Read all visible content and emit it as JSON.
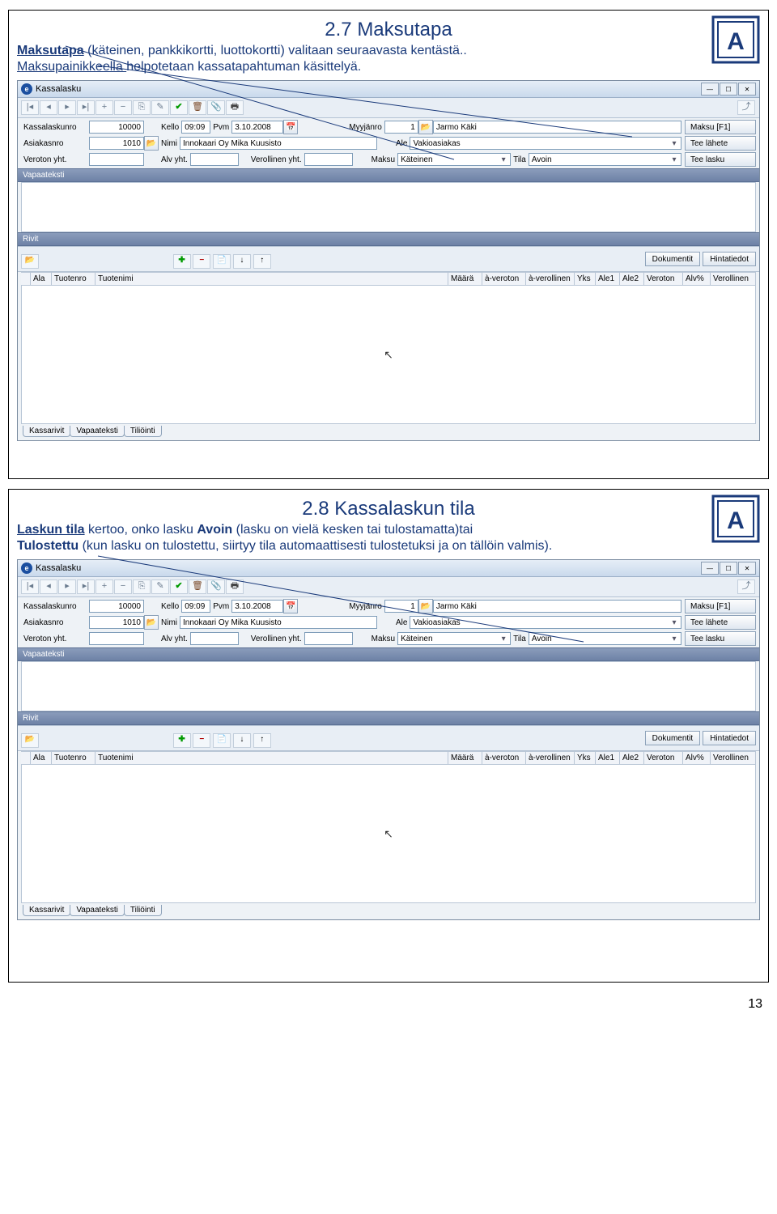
{
  "page_number": "13",
  "slide1": {
    "title": "2.7 Maksutapa",
    "text_parts": {
      "p1a": "Maksutapa",
      "p1b": " (käteinen, pankkikortti, luottokortti) valitaan seuraavasta kentästä.. ",
      "p2a": "Maksupainikkeella ",
      "p2b": "helpotetaan kassatapahtuman käsittelyä."
    }
  },
  "slide2": {
    "title": "2.8 Kassalaskun tila",
    "text_parts": {
      "p1a": "Laskun tila",
      "p1b": " kertoo, onko lasku ",
      "p1c": "Avoin",
      "p1d": " (lasku on vielä kesken tai tulostamatta)tai ",
      "p2a": "Tulostettu",
      "p2b": "  (kun lasku on tulostettu, siirtyy tila automaattisesti tulostetuksi ja on tällöin valmis)."
    }
  },
  "app": {
    "title": "Kassalasku",
    "win": {
      "min": "—",
      "max": "☐",
      "close": "✕"
    },
    "side_buttons": {
      "maksu": "Maksu [F1]",
      "lahete": "Tee lähete",
      "lasku": "Tee lasku"
    },
    "labels": {
      "kassalaskunro": "Kassalaskunro",
      "kello": "Kello",
      "pvm": "Pvm",
      "myyjanro": "Myyjänro",
      "asiakasnro": "Asiakasnro",
      "nimi": "Nimi",
      "ale": "Ale",
      "veroton": "Veroton yht.",
      "alv": "Alv yht.",
      "verollinen": "Verollinen yht.",
      "maksu": "Maksu",
      "tila": "Tila"
    },
    "values": {
      "kassalaskunro": "10000",
      "kello": "09:09",
      "pvm": "3.10.2008",
      "myyjanro": "1",
      "myyja_nimi": "Jarmo Käki",
      "asiakasnro": "1010",
      "nimi": "Innokaari Oy Mika Kuusisto",
      "ale": "Vakioasiakas",
      "veroton": "",
      "alv": "",
      "verollinen": "",
      "maksu": "Käteinen",
      "tila": "Avoin"
    },
    "sections": {
      "vapaateksti": "Vapaateksti",
      "rivit": "Rivit"
    },
    "row_buttons": {
      "dokumentit": "Dokumentit",
      "hintatiedot": "Hintatiedot"
    },
    "grid_headers": {
      "ala": "Ala",
      "tuotenro": "Tuotenro",
      "tuotenimi": "Tuotenimi",
      "maara": "Määrä",
      "averoton": "à-veroton",
      "averollinen": "à-verollinen",
      "yks": "Yks",
      "ale1": "Ale1",
      "ale2": "Ale2",
      "veroton": "Veroton",
      "alvp": "Alv%",
      "verollinen": "Verollinen"
    },
    "tabs": {
      "t1": "Kassarivit",
      "t2": "Vapaateksti",
      "t3": "Tiliöinti"
    },
    "calendar_icon": "📅",
    "folder_icon": "📂",
    "check": "✔",
    "trash": "🗑",
    "print": "🖶",
    "plus": "✚",
    "minus": "−",
    "arrow_down": "▾",
    "cursor": "↖"
  }
}
